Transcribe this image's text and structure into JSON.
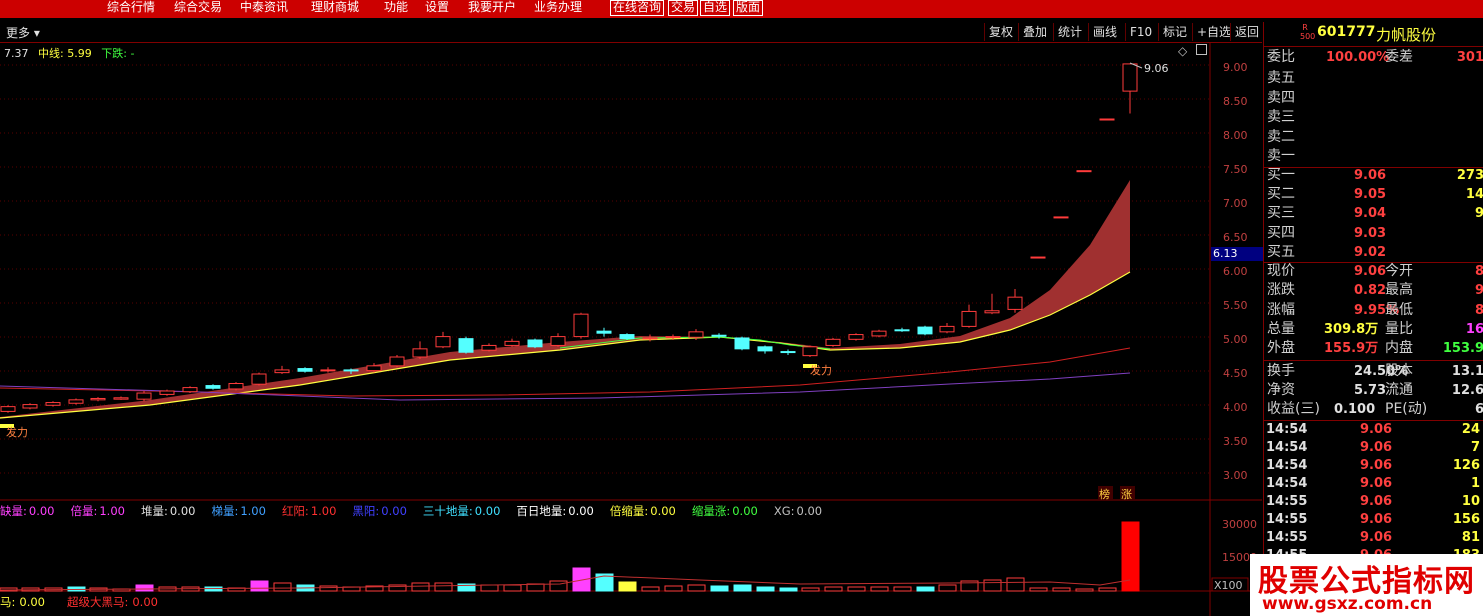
{
  "menu": {
    "items": [
      "综合行情",
      "综合交易",
      "中泰资讯",
      "理财商城",
      "功能",
      "设置",
      "我要开户",
      "业务办理"
    ],
    "buttons": [
      "在线咨询",
      "交易",
      "自选",
      "版面"
    ]
  },
  "toolbar": {
    "more": "更多",
    "buttons": [
      "复权",
      "叠加",
      "统计",
      "画线",
      "F10",
      "标记",
      "+自选",
      "返回"
    ]
  },
  "info_line": {
    "val1": "7.37",
    "mid_label": "中线:",
    "mid_value": "5.99",
    "down_label": "下跌:",
    "down_value": "-"
  },
  "chart": {
    "high_label": "9.06",
    "price_marker": "6.13",
    "signal_labels": [
      "发力",
      "发力"
    ],
    "tags": [
      "榜",
      "涨"
    ],
    "axis_labels": [
      "9.00",
      "8.50",
      "8.00",
      "7.50",
      "7.00",
      "6.50",
      "6.00",
      "5.50",
      "5.00",
      "4.50",
      "4.00",
      "3.50",
      "3.00"
    ],
    "volume_axis": [
      "30000",
      "15000"
    ],
    "volume_unit": "X100",
    "colors": {
      "up": "#ff3b3b",
      "down": "#54ffff",
      "ribbon": "#a03030",
      "yellow": "#ffff40",
      "purple": "#8040c0",
      "red": "#d02020"
    }
  },
  "indicators": [
    {
      "label": "缺量:",
      "value": "0.00",
      "color": "#ff40ff"
    },
    {
      "label": "倍量:",
      "value": "1.00",
      "color": "#ff40ff"
    },
    {
      "label": "堆量:",
      "value": "0.00",
      "color": "#e0e0e0"
    },
    {
      "label": "梯量:",
      "value": "1.00",
      "color": "#40a0ff"
    },
    {
      "label": "红阳:",
      "value": "1.00",
      "color": "#ff3030"
    },
    {
      "label": "黑阳:",
      "value": "0.00",
      "color": "#4040ff"
    },
    {
      "label": "三十地量:",
      "value": "0.00",
      "color": "#40e0ff"
    },
    {
      "label": "百日地量:",
      "value": "0.00",
      "color": "#ffffff"
    },
    {
      "label": "倍缩量:",
      "value": "0.00",
      "color": "#ffff40"
    },
    {
      "label": "缩量涨:",
      "value": "0.00",
      "color": "#40ff40"
    },
    {
      "label": "XG:",
      "value": "0.00",
      "color": "#c0c0c0"
    }
  ],
  "bottom_indicators": [
    {
      "label": "马:",
      "value": "0.00",
      "color": "#ffff40"
    },
    {
      "label": "超级大黑马:",
      "value": "0.00",
      "color": "#ff3030"
    }
  ],
  "stock": {
    "code": "601777",
    "name": "力帆股份",
    "badge_top": "R",
    "badge_bottom": "500"
  },
  "order_book": {
    "weibi_label": "委比",
    "weibi_value": "100.00%",
    "weicha_label": "委差",
    "weicha_value": "301",
    "sells": [
      {
        "label": "卖五",
        "price": "",
        "vol": ""
      },
      {
        "label": "卖四",
        "price": "",
        "vol": ""
      },
      {
        "label": "卖三",
        "price": "",
        "vol": ""
      },
      {
        "label": "卖二",
        "price": "",
        "vol": ""
      },
      {
        "label": "卖一",
        "price": "",
        "vol": ""
      }
    ],
    "buys": [
      {
        "label": "买一",
        "price": "9.06",
        "vol": "273"
      },
      {
        "label": "买二",
        "price": "9.05",
        "vol": "14"
      },
      {
        "label": "买三",
        "price": "9.04",
        "vol": "9"
      },
      {
        "label": "买四",
        "price": "9.03",
        "vol": ""
      },
      {
        "label": "买五",
        "price": "9.02",
        "vol": ""
      }
    ]
  },
  "quote": [
    {
      "l1": "现价",
      "v1": "9.06",
      "l2": "今开",
      "v2": "8",
      "c1": "#ff4040",
      "c2": "#ff4040"
    },
    {
      "l1": "涨跌",
      "v1": "0.82",
      "l2": "最高",
      "v2": "9",
      "c1": "#ff4040",
      "c2": "#ff4040"
    },
    {
      "l1": "涨幅",
      "v1": "9.95%",
      "l2": "最低",
      "v2": "8",
      "c1": "#ff4040",
      "c2": "#ff4040"
    },
    {
      "l1": "总量",
      "v1": "309.8万",
      "l2": "量比",
      "v2": "16",
      "c1": "#ffff40",
      "c2": "#ff40ff"
    },
    {
      "l1": "外盘",
      "v1": "155.9万",
      "l2": "内盘",
      "v2": "153.9",
      "c1": "#ff4040",
      "c2": "#40ff40"
    },
    {
      "l1": "换手",
      "v1": "24.50%",
      "l2": "股本",
      "v2": "13.1",
      "c1": "#e0e0e0",
      "c2": "#e0e0e0"
    },
    {
      "l1": "净资",
      "v1": "5.73",
      "l2": "流通",
      "v2": "12.6",
      "c1": "#e0e0e0",
      "c2": "#e0e0e0"
    },
    {
      "l1": "收益(三)",
      "v1": "0.100",
      "l2": "PE(动)",
      "v2": "6",
      "c1": "#e0e0e0",
      "c2": "#e0e0e0"
    }
  ],
  "ticks": [
    {
      "time": "14:54",
      "price": "9.06",
      "vol": "24"
    },
    {
      "time": "14:54",
      "price": "9.06",
      "vol": "7"
    },
    {
      "time": "14:54",
      "price": "9.06",
      "vol": "126"
    },
    {
      "time": "14:54",
      "price": "9.06",
      "vol": "1"
    },
    {
      "time": "14:55",
      "price": "9.06",
      "vol": "10"
    },
    {
      "time": "14:55",
      "price": "9.06",
      "vol": "156"
    },
    {
      "time": "14:55",
      "price": "9.06",
      "vol": "81"
    },
    {
      "time": "14:55",
      "price": "9.06",
      "vol": "183"
    }
  ],
  "watermark": {
    "title": "股票公式指标网",
    "url": "www.gsxz.com.cn"
  }
}
